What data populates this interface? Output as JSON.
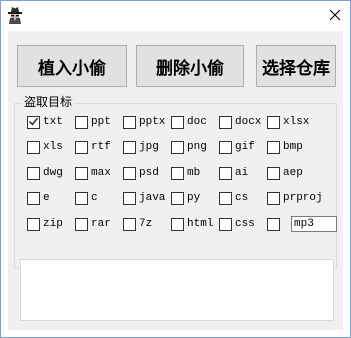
{
  "titlebar": {
    "close_symbol": "✕",
    "icon": "spy-icon"
  },
  "actions": {
    "implant_label": "植入小偷",
    "delete_label": "删除小偷",
    "choose_repo_label": "选择仓库"
  },
  "targets": {
    "group_label": "盗取目标",
    "items": [
      {
        "label": "txt",
        "checked": true
      },
      {
        "label": "ppt",
        "checked": false
      },
      {
        "label": "pptx",
        "checked": false
      },
      {
        "label": "doc",
        "checked": false
      },
      {
        "label": "docx",
        "checked": false
      },
      {
        "label": "xlsx",
        "checked": false
      },
      {
        "label": "xls",
        "checked": false
      },
      {
        "label": "rtf",
        "checked": false
      },
      {
        "label": "jpg",
        "checked": false
      },
      {
        "label": "png",
        "checked": false
      },
      {
        "label": "gif",
        "checked": false
      },
      {
        "label": "bmp",
        "checked": false
      },
      {
        "label": "dwg",
        "checked": false
      },
      {
        "label": "max",
        "checked": false
      },
      {
        "label": "psd",
        "checked": false
      },
      {
        "label": "mb",
        "checked": false
      },
      {
        "label": "ai",
        "checked": false
      },
      {
        "label": "aep",
        "checked": false
      },
      {
        "label": "e",
        "checked": false
      },
      {
        "label": "c",
        "checked": false
      },
      {
        "label": "java",
        "checked": false
      },
      {
        "label": "py",
        "checked": false
      },
      {
        "label": "cs",
        "checked": false
      },
      {
        "label": "prproj",
        "checked": false
      },
      {
        "label": "zip",
        "checked": false
      },
      {
        "label": "rar",
        "checked": false
      },
      {
        "label": "7z",
        "checked": false
      },
      {
        "label": "html",
        "checked": false
      },
      {
        "label": "css",
        "checked": false
      }
    ],
    "custom_checked": false,
    "custom_value": "mp3"
  },
  "log": {
    "text": ""
  }
}
